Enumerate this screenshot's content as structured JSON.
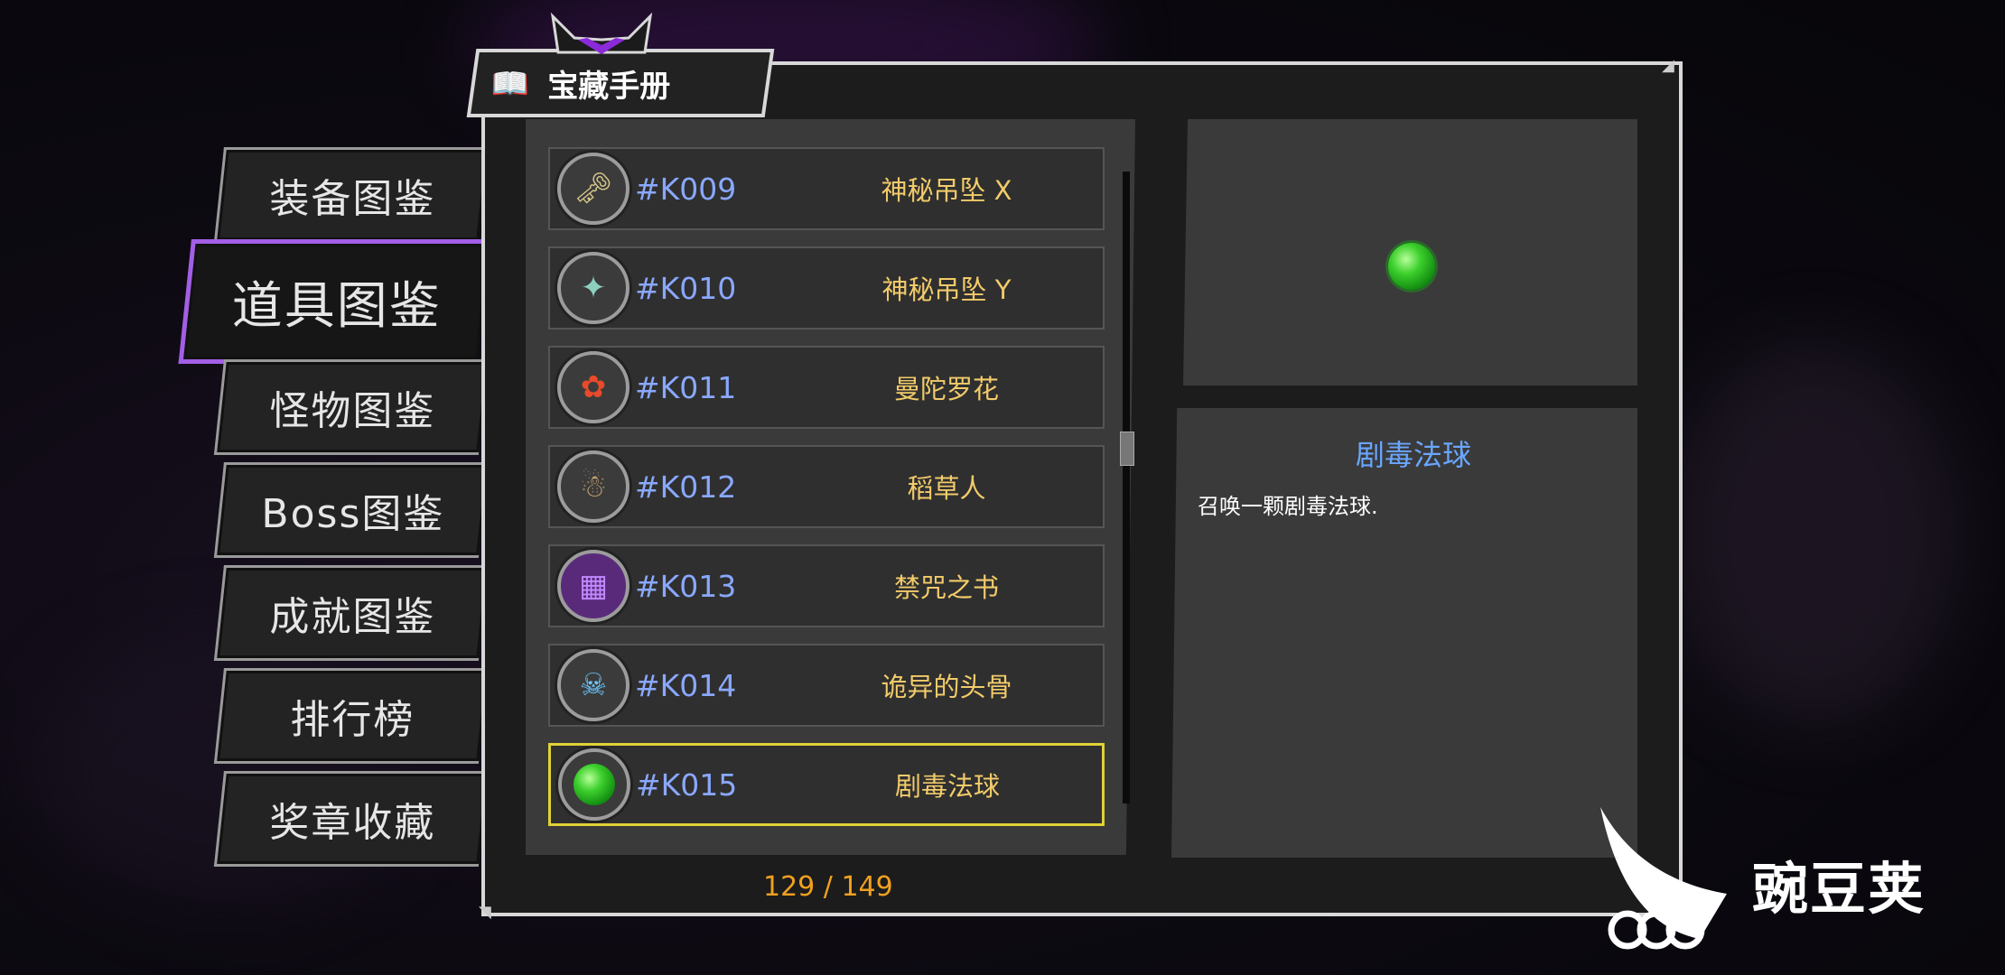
{
  "window": {
    "title": "宝藏手册"
  },
  "tabs": [
    {
      "label": "装备图鉴",
      "active": false
    },
    {
      "label": "道具图鉴",
      "active": true
    },
    {
      "label": "怪物图鉴",
      "active": false
    },
    {
      "label": "Boss图鉴",
      "active": false
    },
    {
      "label": "成就图鉴",
      "active": false
    },
    {
      "label": "排行榜",
      "active": false
    },
    {
      "label": "奖章收藏",
      "active": false
    }
  ],
  "items": [
    {
      "code": "#K009",
      "name": "神秘吊坠 X",
      "icon": "pendant-icon"
    },
    {
      "code": "#K010",
      "name": "神秘吊坠 Y",
      "icon": "pendant-icon"
    },
    {
      "code": "#K011",
      "name": "曼陀罗花",
      "icon": "flower-icon"
    },
    {
      "code": "#K012",
      "name": "稻草人",
      "icon": "scarecrow-icon"
    },
    {
      "code": "#K013",
      "name": "禁咒之书",
      "icon": "book-icon"
    },
    {
      "code": "#K014",
      "name": "诡异的头骨",
      "icon": "skull-icon"
    },
    {
      "code": "#K015",
      "name": "剧毒法球",
      "icon": "green-orb-icon",
      "selected": true
    }
  ],
  "pagination": {
    "text": "129 / 149"
  },
  "detail": {
    "title": "剧毒法球",
    "description": "召唤一颗剧毒法球."
  },
  "colors": {
    "accent_purple": "#a35ee6",
    "code_blue": "#8aa8ff",
    "name_gold": "#f2cb6a",
    "count_orange": "#f0a020",
    "selected_yellow": "#e0d236",
    "detail_title_blue": "#6aa6ff"
  },
  "watermark": {
    "text": "豌豆荚"
  }
}
